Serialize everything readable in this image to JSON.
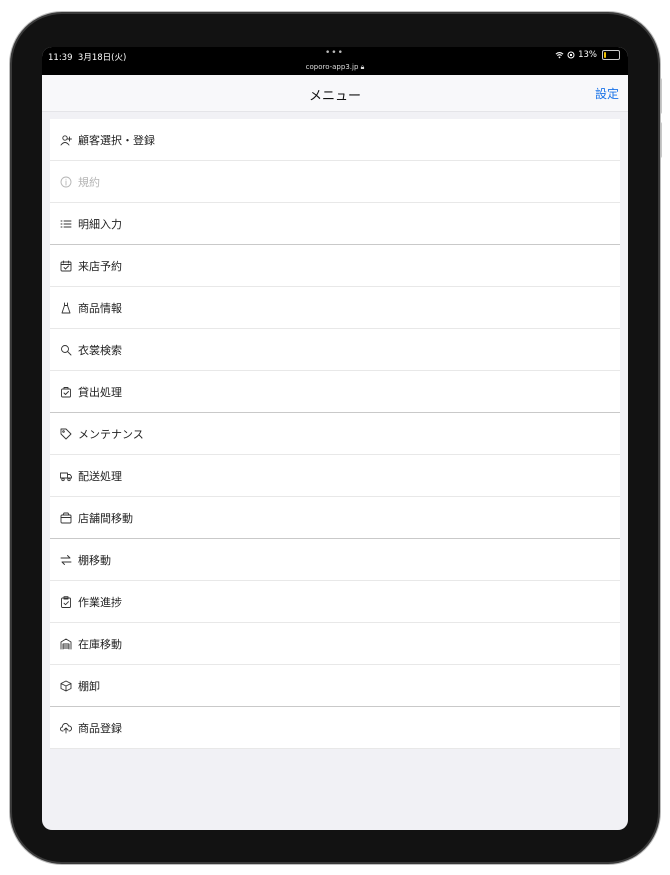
{
  "status_bar": {
    "time": "11:39",
    "date": "3月18日(火)",
    "dots": "•••",
    "url": "coporo-app3.jp",
    "battery": "13%",
    "battery_level": 0.13
  },
  "nav": {
    "title": "メニュー",
    "right_label": "設定"
  },
  "menu_items": [
    {
      "label": "顧客選択・登録",
      "icon": "add-user-icon",
      "disabled": false
    },
    {
      "label": "規約",
      "icon": "info-icon",
      "disabled": true
    },
    {
      "label": "明細入力",
      "icon": "list-icon",
      "disabled": false
    },
    {
      "label": "来店予約",
      "icon": "calendar-icon",
      "disabled": false
    },
    {
      "label": "商品情報",
      "icon": "dress-icon",
      "disabled": false
    },
    {
      "label": "衣裳検索",
      "icon": "search-icon",
      "disabled": false
    },
    {
      "label": "貸出処理",
      "icon": "bag-check-icon",
      "disabled": false
    },
    {
      "label": "メンテナンス",
      "icon": "tag-icon",
      "disabled": false
    },
    {
      "label": "配送処理",
      "icon": "truck-icon",
      "disabled": false
    },
    {
      "label": "店舗間移動",
      "icon": "store-icon",
      "disabled": false
    },
    {
      "label": "棚移動",
      "icon": "swap-arrows-icon",
      "disabled": false
    },
    {
      "label": "作業進捗",
      "icon": "clipboard-check-icon",
      "disabled": false
    },
    {
      "label": "在庫移動",
      "icon": "warehouse-icon",
      "disabled": false
    },
    {
      "label": "棚卸",
      "icon": "box-icon",
      "disabled": false
    },
    {
      "label": "商品登録",
      "icon": "cloud-upload-icon",
      "disabled": false
    }
  ],
  "colors": {
    "accent": "#1a73e8",
    "disabled": "#b5b5b5",
    "battery": "#f2c200"
  }
}
